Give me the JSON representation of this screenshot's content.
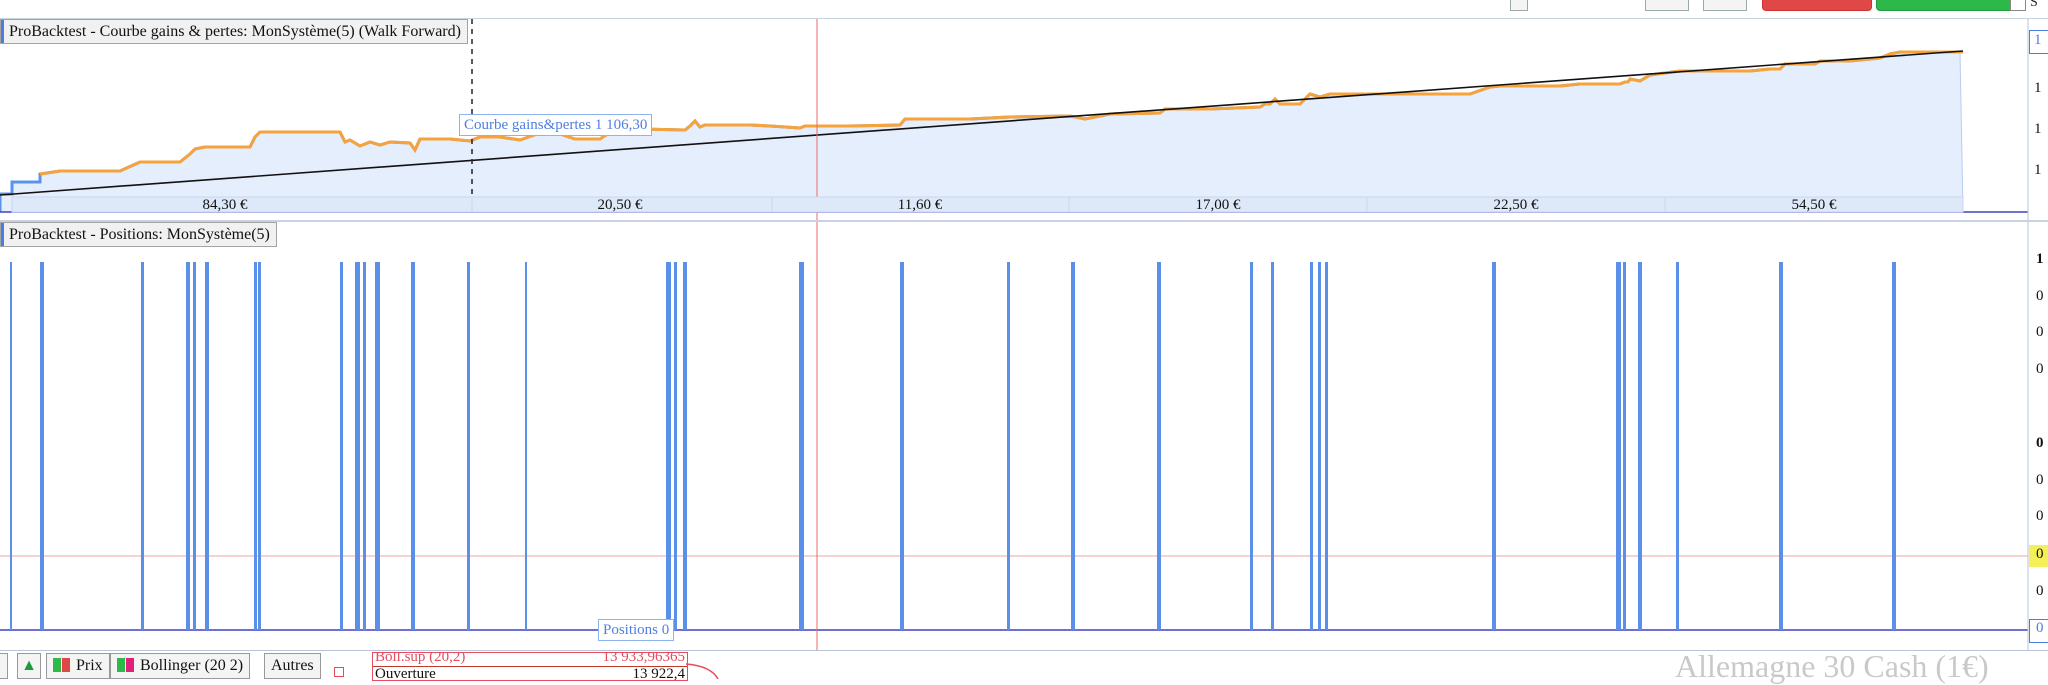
{
  "equity_panel": {
    "title": "ProBacktest - Courbe gains & pertes: MonSystème(5) (Walk Forward)",
    "cursor_label": "Courbe gains&pertes",
    "cursor_value": "1 106,30",
    "segment_labels": [
      "84,30 €",
      "20,50 €",
      "11,60 €",
      "17,00 €",
      "22,50 €",
      "54,50 €"
    ],
    "axis_ticks": [
      "1",
      "1",
      "1",
      "1"
    ],
    "colors": {
      "line": "#f6a33b",
      "line_alt": "#5c93ea",
      "fill": "#e5eefc",
      "trend": "#000000"
    }
  },
  "positions_panel": {
    "title": "ProBacktest - Positions: MonSystème(5)",
    "cursor_label": "Positions",
    "cursor_value": "0",
    "axis_ticks": [
      "1",
      "0",
      "0",
      "0",
      "0",
      "0",
      "0",
      "0",
      "0",
      "0"
    ],
    "bar_color": "#5a90ea"
  },
  "bottom_bar": {
    "tabs": [
      "Prix",
      "Bollinger (20 2)",
      "Autres"
    ],
    "info_header_label": "Boll.sup (20,2)",
    "info_header_value": "13 933,96365",
    "info_row_label": "Ouverture",
    "info_row_value": "13 922,4",
    "watermark": "Allemagne 30 Cash (1€)"
  },
  "top_bar": {
    "checkbox_label": "S"
  }
}
